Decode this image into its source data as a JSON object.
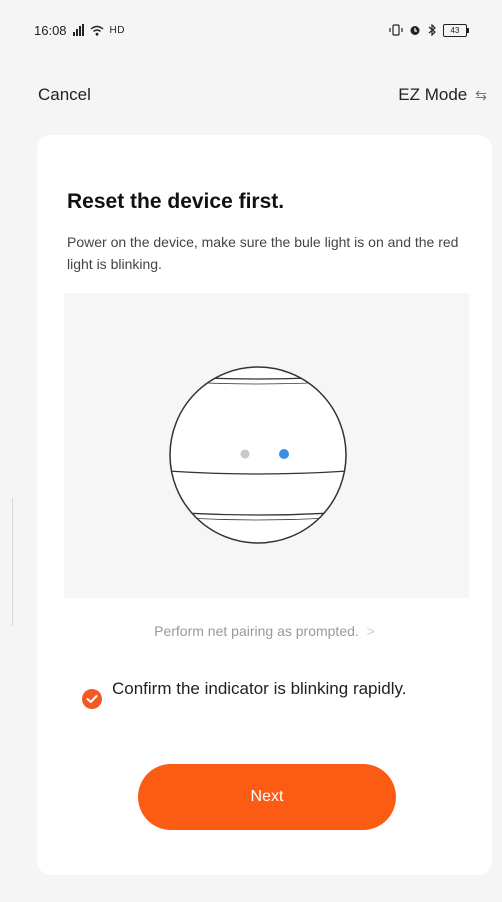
{
  "status_bar": {
    "time": "16:08",
    "network_label": "HD",
    "battery": "43"
  },
  "nav": {
    "cancel_label": "Cancel",
    "mode_label": "EZ Mode"
  },
  "content": {
    "title": "Reset the device first.",
    "description": "Power on the device, make sure the bule light is on and the red light is blinking.",
    "prompt_link": "Perform net pairing as prompted.",
    "confirm_label": "Confirm the indicator is blinking rapidly.",
    "confirm_checked": true,
    "next_label": "Next"
  },
  "colors": {
    "accent": "#fb5b12",
    "check": "#f15a22",
    "blue_light": "#3b8fe0",
    "grey_light": "#c8c8c8"
  },
  "icons": {
    "signal": "signal-icon",
    "wifi": "wifi-icon",
    "battery": "battery-icon",
    "swap": "swap-icon",
    "chevron": "chevron-right-icon",
    "check": "check-icon"
  }
}
